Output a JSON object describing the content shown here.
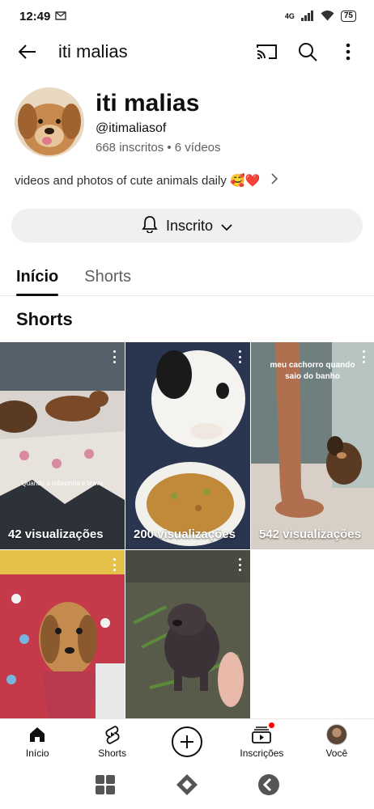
{
  "status_bar": {
    "time": "12:49",
    "network": "4G",
    "battery": "75"
  },
  "app_bar": {
    "title": "iti malias"
  },
  "channel": {
    "name": "iti malias",
    "handle": "@itimaliasof",
    "stats": "668 inscritos • 6 vídeos",
    "description": "videos and photos of cute animals daily 🥰❤️",
    "subscribe_label": "Inscrito"
  },
  "tabs": [
    {
      "label": "Início",
      "active": true
    },
    {
      "label": "Shorts",
      "active": false
    }
  ],
  "section_title": "Shorts",
  "shorts": [
    {
      "views": "42 visualizações",
      "overlay_text": "Quando a mãezinha é brava"
    },
    {
      "views": "200 visualizações"
    },
    {
      "views": "542 visualizações",
      "caption": "meu cachorro quando saio do banho"
    },
    {
      "views": ""
    },
    {
      "views": ""
    }
  ],
  "bottom_nav": [
    {
      "label": "Início",
      "icon": "home-icon"
    },
    {
      "label": "Shorts",
      "icon": "shorts-icon"
    },
    {
      "label": "",
      "icon": "create-icon"
    },
    {
      "label": "Inscrições",
      "icon": "subscriptions-icon"
    },
    {
      "label": "Você",
      "icon": "profile-icon"
    }
  ],
  "colors": {
    "text": "#0f0f0f",
    "secondary": "#606060",
    "chip_bg": "#f0f0f0",
    "notif": "#ff0000"
  }
}
